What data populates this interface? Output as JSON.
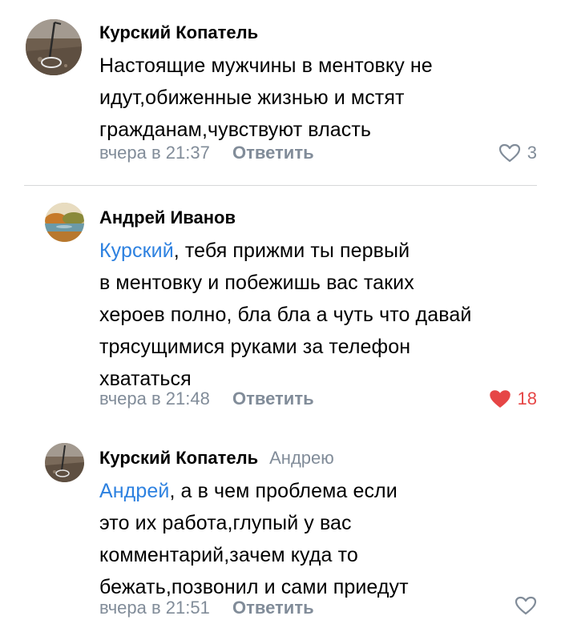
{
  "comments": [
    {
      "author": "Курский Копатель",
      "reply_to": "",
      "mention": "",
      "text": "Настоящие мужчины в ментовку не\nидут,обиженные жизнью и мстят\nгражданам,чувствуют власть",
      "time": "вчера в 21:37",
      "reply_label": "Ответить",
      "likes": "3",
      "liked": false,
      "avatar": "metal-detector-field-avatar"
    },
    {
      "author": "Андрей Иванов",
      "reply_to": "",
      "mention": "Курский",
      "text": ", тебя прижми ты первый\nв ментовку и побежишь вас таких\nхероев полно, бла бла а чуть что давай\nтрясущимися руками за телефон\nхвататься",
      "time": "вчера в 21:48",
      "reply_label": "Ответить",
      "likes": "18",
      "liked": true,
      "avatar": "autumn-lake-avatar"
    },
    {
      "author": "Курский Копатель",
      "reply_to": "Андрею",
      "mention": "Андрей",
      "text": ", а в чем проблема если\nэто их работа,глупый у вас\nкомментарий,зачем куда то\nбежать,позвонил и сами приедут",
      "time": "вчера в 21:51",
      "reply_label": "Ответить",
      "likes": "",
      "liked": false,
      "avatar": "metal-detector-field-avatar"
    }
  ],
  "colors": {
    "mention": "#2d81e0",
    "meta": "#818c99",
    "liked_heart": "#e64646",
    "divider": "#d7d8d9"
  }
}
